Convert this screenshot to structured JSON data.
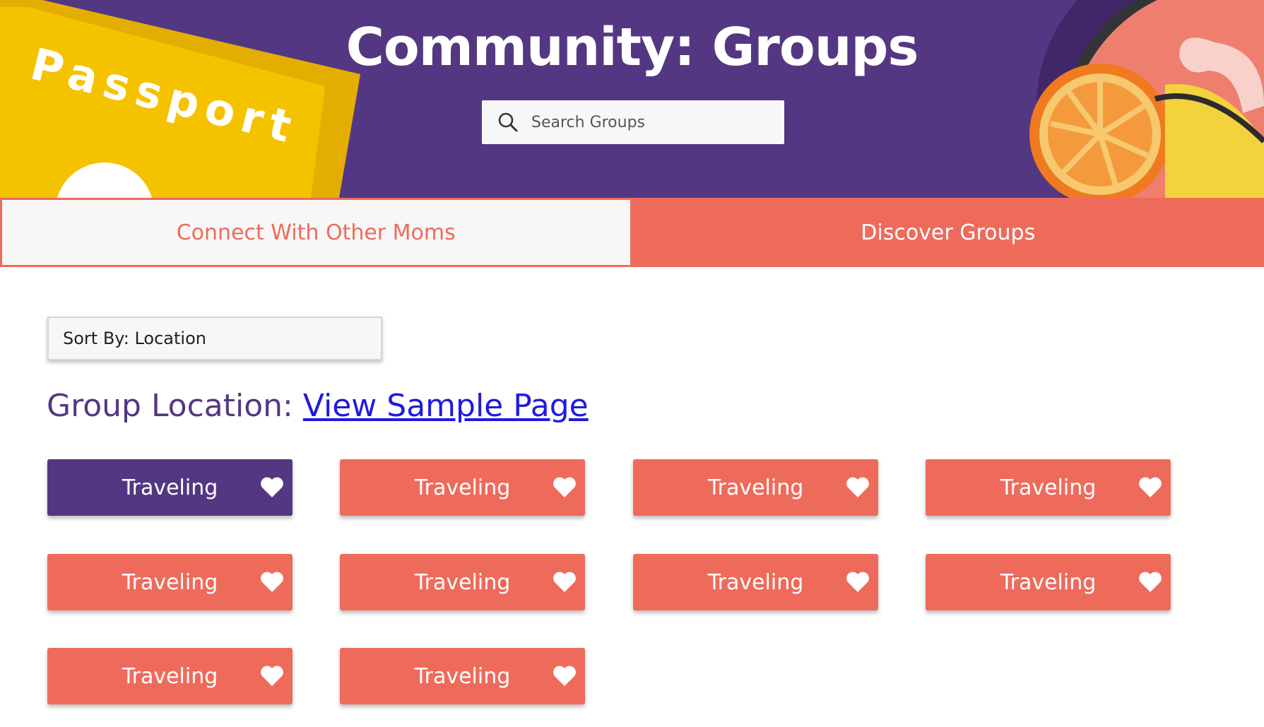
{
  "header": {
    "title": "Community: Groups",
    "art_left_label": "Passport",
    "search": {
      "placeholder": "Search Groups"
    }
  },
  "tabs": [
    {
      "label": "Connect With Other Moms",
      "active": true
    },
    {
      "label": "Discover Groups",
      "active": false
    }
  ],
  "sort": {
    "label": "Sort By: Location"
  },
  "group_location": {
    "prefix": "Group Location: ",
    "link_text": "View Sample Page"
  },
  "groups": [
    {
      "label": "Traveling",
      "selected": true
    },
    {
      "label": "Traveling",
      "selected": false
    },
    {
      "label": "Traveling",
      "selected": false
    },
    {
      "label": "Traveling",
      "selected": false
    },
    {
      "label": "Traveling",
      "selected": false
    },
    {
      "label": "Traveling",
      "selected": false
    },
    {
      "label": "Traveling",
      "selected": false
    },
    {
      "label": "Traveling",
      "selected": false
    },
    {
      "label": "Traveling",
      "selected": false
    },
    {
      "label": "Traveling",
      "selected": false
    }
  ],
  "colors": {
    "brand_purple": "#543782",
    "accent_coral": "#ee6b5c",
    "link_blue": "#1f1ae0",
    "passport_yellow": "#f5c200"
  },
  "icons": {
    "search": "search-icon",
    "heart": "heart-icon"
  }
}
